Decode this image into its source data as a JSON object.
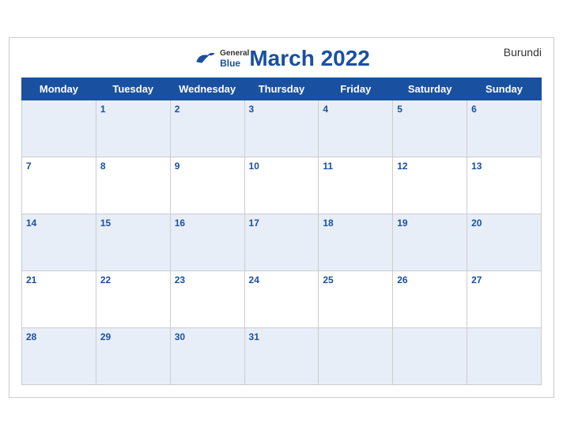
{
  "header": {
    "title": "March 2022",
    "country": "Burundi",
    "logo": {
      "general": "General",
      "blue": "Blue"
    }
  },
  "weekdays": [
    "Monday",
    "Tuesday",
    "Wednesday",
    "Thursday",
    "Friday",
    "Saturday",
    "Sunday"
  ],
  "weeks": [
    [
      "",
      "1",
      "2",
      "3",
      "4",
      "5",
      "6"
    ],
    [
      "7",
      "8",
      "9",
      "10",
      "11",
      "12",
      "13"
    ],
    [
      "14",
      "15",
      "16",
      "17",
      "18",
      "19",
      "20"
    ],
    [
      "21",
      "22",
      "23",
      "24",
      "25",
      "26",
      "27"
    ],
    [
      "28",
      "29",
      "30",
      "31",
      "",
      "",
      ""
    ]
  ]
}
